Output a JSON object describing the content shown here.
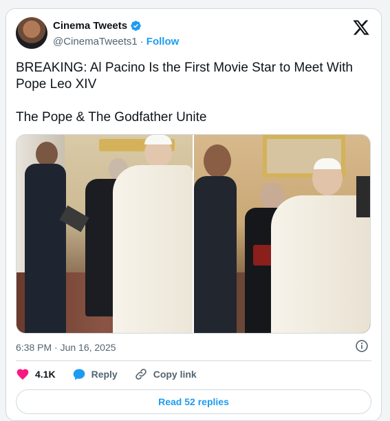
{
  "author": {
    "name": "Cinema Tweets",
    "handle": "@CinemaTweets1",
    "separator": "·",
    "follow_label": "Follow",
    "verified": true
  },
  "tweet": {
    "text": "BREAKING: Al Pacino Is the First Movie Star to Meet With Pope Leo XIV\n\nThe Pope & The Godfather Unite",
    "timestamp": "6:38 PM · Jun 16, 2025"
  },
  "actions": {
    "likes_count": "4.1K",
    "reply_label": "Reply",
    "copy_link_label": "Copy link"
  },
  "replies": {
    "label": "Read 52 replies"
  },
  "colors": {
    "accent": "#1d9bf0",
    "like": "#f91880",
    "muted": "#536471",
    "border": "#cfd9de"
  },
  "icons": [
    "verified-badge-icon",
    "x-logo-icon",
    "info-icon",
    "heart-icon",
    "reply-icon",
    "link-icon"
  ]
}
